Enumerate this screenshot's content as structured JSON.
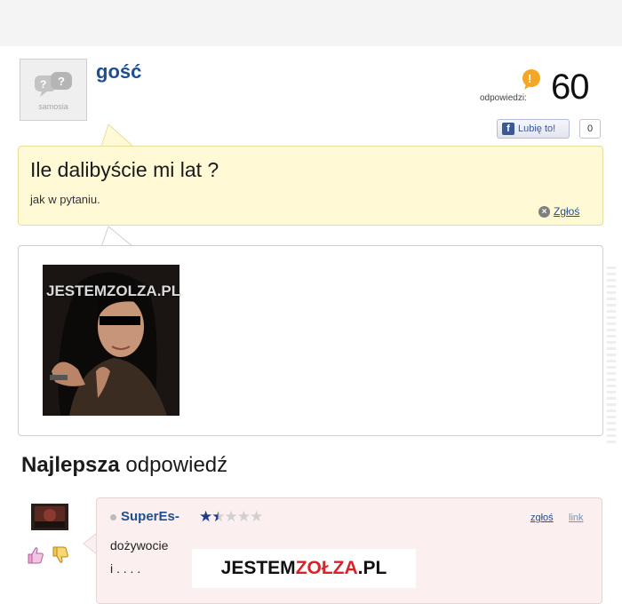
{
  "question": {
    "username": "gość",
    "avatar_logo": "samosia",
    "answers_label": "odpowiedzi:",
    "answers_count": "60",
    "like_label": "Lubię to!",
    "like_count": "0",
    "title": "Ile dalibyście mi lat ?",
    "body": "jak w pytaniu.",
    "report_label": "Zgłoś"
  },
  "photo": {
    "watermark_prefix": "JESTEM",
    "watermark_mid": "ZOLZA",
    "watermark_suffix": ".PL"
  },
  "best_answer": {
    "heading_bold": "Najlepsza",
    "heading_rest": "odpowiedź",
    "username": "SuperEs-",
    "rating": 1.5,
    "rating_max": 5,
    "report_label": "zgłoś",
    "link_label": "link",
    "text": "dożywocie",
    "text_cut": "i  . .  . ."
  },
  "footer_watermark": {
    "prefix": "JESTEM",
    "mid": "ZOŁZA",
    "suffix": ".PL"
  },
  "colors": {
    "username_blue": "#1f4f8f",
    "question_bg": "#fff9d6",
    "answer_bg": "#fcefef",
    "star_filled": "#1f3a8a",
    "star_empty": "#d0d0d0",
    "watermark_red": "#d8232a"
  }
}
